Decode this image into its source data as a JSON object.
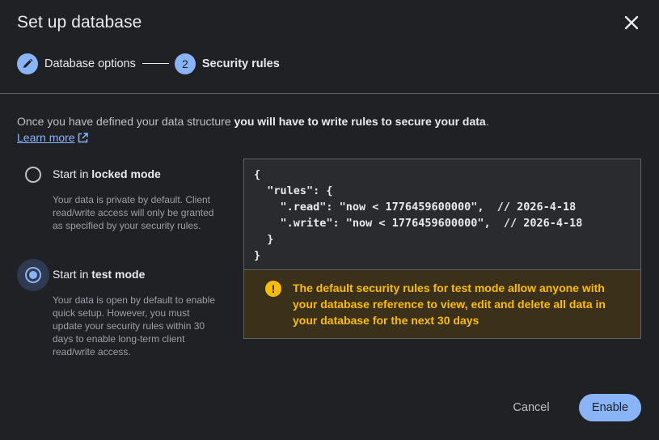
{
  "dialog": {
    "title": "Set up database"
  },
  "stepper": {
    "step1": {
      "label": "Database options",
      "icon": "pencil-icon"
    },
    "step2": {
      "number": "2",
      "label": "Security rules"
    }
  },
  "intro": {
    "text_plain": "Once you have defined your data structure ",
    "text_bold": "you will have to write rules to secure your data",
    "text_end": ".",
    "learn_more": "Learn more"
  },
  "options": {
    "locked": {
      "prefix": "Start in ",
      "bold": "locked mode",
      "description": "Your data is private by default. Client read/write access will only be granted as specified by your security rules.",
      "selected": false
    },
    "test": {
      "prefix": "Start in ",
      "bold": "test mode",
      "description": "Your data is open by default to enable quick setup. However, you must update your security rules within 30 days to enable long-term client read/write access.",
      "selected": true
    }
  },
  "code": "{\n  \"rules\": {\n    \".read\": \"now < 1776459600000\",  // 2026-4-18\n    \".write\": \"now < 1776459600000\",  // 2026-4-18\n  }\n}",
  "warning": {
    "icon": "exclamation-icon",
    "text": "The default security rules for test mode allow anyone with your database reference to view, edit and delete all data in your database for the next 30 days"
  },
  "actions": {
    "cancel": "Cancel",
    "enable": "Enable"
  },
  "colors": {
    "background": "#202124",
    "accent": "#8ab4f8",
    "warning": "#fbbc04"
  }
}
